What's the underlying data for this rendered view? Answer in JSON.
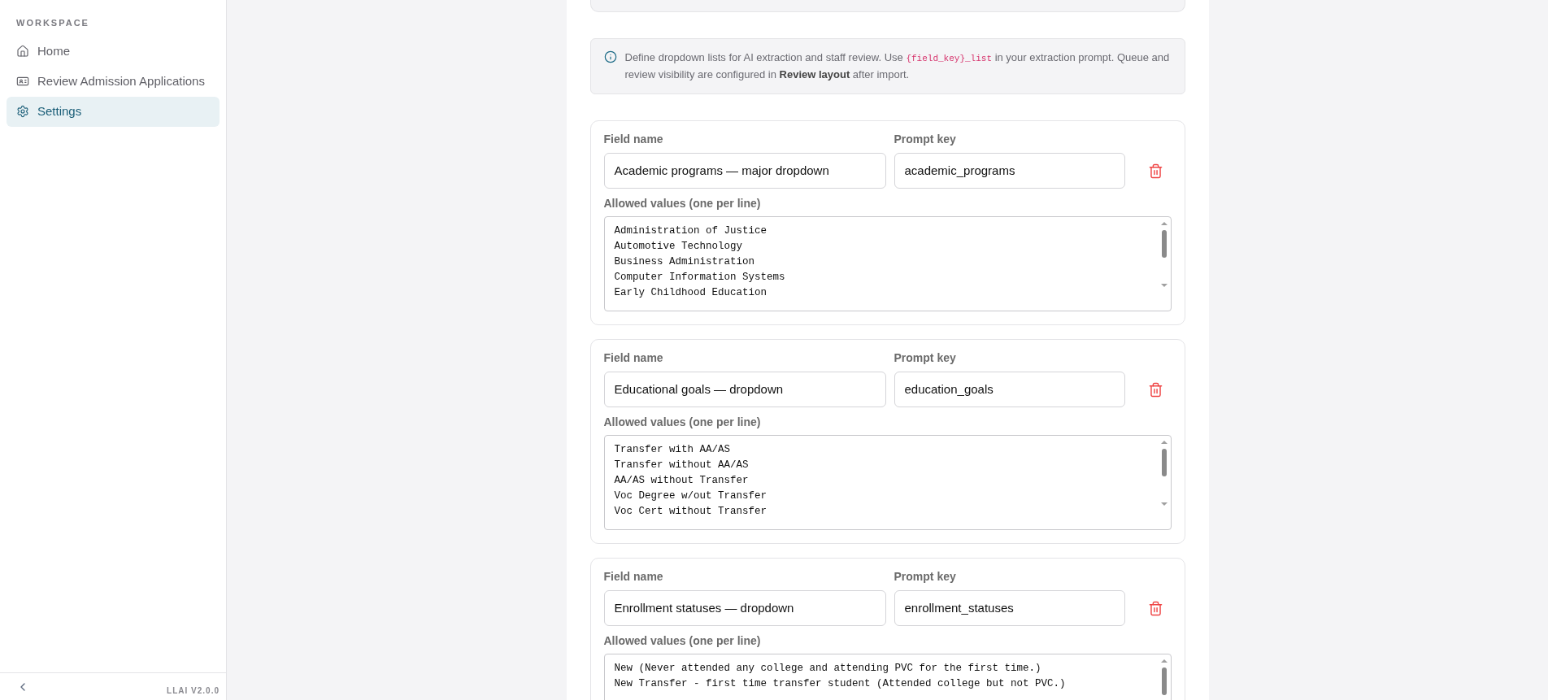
{
  "sidebar": {
    "section_label": "WORKSPACE",
    "items": [
      {
        "label": "Home",
        "selected": false
      },
      {
        "label": "Review Admission Applications",
        "selected": false
      },
      {
        "label": "Settings",
        "selected": true
      }
    ],
    "version": "LLAI V2.0.0"
  },
  "info": {
    "before": "Define dropdown lists for AI extraction and staff review. Use ",
    "code": "{field_key}_list",
    "after": " in your extraction prompt. Queue and review visibility are configured in **Review layout** after import."
  },
  "dropdowns": [
    {
      "field_name_label": "Field name",
      "field_name": "Academic programs — major dropdown",
      "prompt_key_label": "Prompt key",
      "prompt_key": "academic_programs",
      "values_label": "Allowed values (one per line)",
      "values": [
        "Administration of Justice",
        "Automotive Technology",
        "Business Administration",
        "Computer Information Systems",
        "Early Childhood Education"
      ]
    },
    {
      "field_name_label": "Field name",
      "field_name": "Educational goals — dropdown",
      "prompt_key_label": "Prompt key",
      "prompt_key": "education_goals",
      "values_label": "Allowed values (one per line)",
      "values": [
        "Transfer with AA/AS",
        "Transfer without AA/AS",
        "AA/AS without Transfer",
        "Voc Degree w/out Transfer",
        "Voc Cert without Transfer"
      ]
    },
    {
      "field_name_label": "Field name",
      "field_name": "Enrollment statuses — dropdown",
      "prompt_key_label": "Prompt key",
      "prompt_key": "enrollment_statuses",
      "values_label": "Allowed values (one per line)",
      "values": [
        "New (Never attended any college and attending PVC for the first time.)",
        "New Transfer - first time transfer student (Attended college but not PVC.)"
      ]
    }
  ]
}
